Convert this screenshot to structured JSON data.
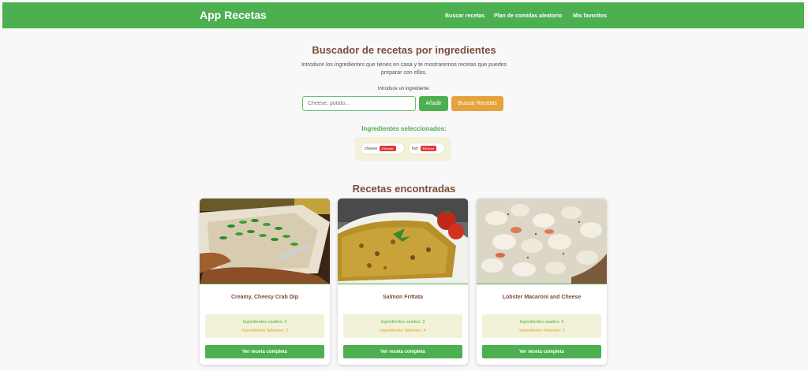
{
  "app": {
    "title": "App Recetas",
    "brand_color": "#4caf50"
  },
  "nav": {
    "items": [
      {
        "label": "Buscar recetas"
      },
      {
        "label": "Plan de comidas aleatorio"
      },
      {
        "label": "Mis favoritos"
      }
    ]
  },
  "search": {
    "title": "Buscador de recetas por ingredientes",
    "intro": "Introduce los ingredientes que tienes en casa y te mostraremos recetas que puedes preparar con ellos.",
    "input_label": "Introduce un ingrediente:",
    "input_value": "",
    "placeholder": "Cheese, potato...",
    "add_label": "Añadir",
    "search_label": "Buscar Recetas"
  },
  "selected": {
    "title": "Ingredientes seleccionados:",
    "remove_label": "Eliminar",
    "items": [
      {
        "name": "cheese"
      },
      {
        "name": "fish"
      }
    ]
  },
  "results": {
    "title": "Recetas encontradas",
    "view_label": "Ver receta completa",
    "recipes": [
      {
        "title": "Creamy, Cheesy Crab Dip",
        "used": "Ingredientes usados: 3",
        "missing": "Ingredientes faltantes: 3"
      },
      {
        "title": "Salmon Frittata",
        "used": "Ingredientes usados: 3",
        "missing": "Ingredientes faltantes: 4"
      },
      {
        "title": "Lobster Macaroni and Cheese",
        "used": "Ingredientes usados: 3",
        "missing": "Ingredientes faltantes: 6"
      }
    ]
  }
}
